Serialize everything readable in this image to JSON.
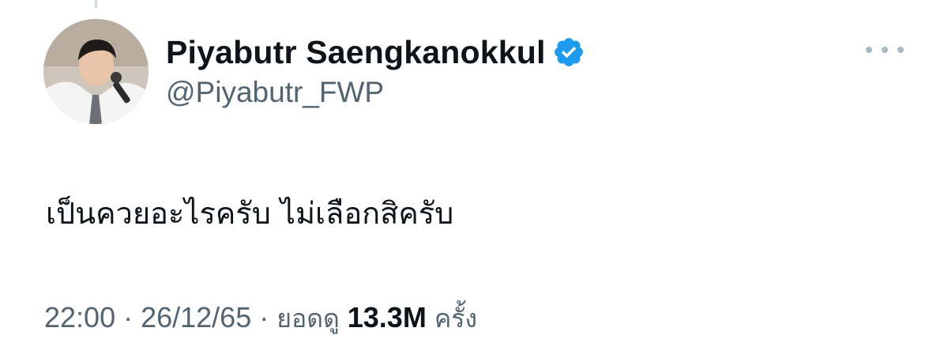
{
  "tweet": {
    "author": {
      "display_name": "Piyabutr Saengkanokkul",
      "handle": "@Piyabutr_FWP",
      "verified": true,
      "verified_icon": "verified-badge-icon"
    },
    "text": "เป็นควยอะไรครับ ไม่เลือกสิครับ",
    "meta": {
      "time": "22:00",
      "separator": "·",
      "date": "26/12/65",
      "views_prefix": "ยอดดู",
      "views_count": "13.3M",
      "views_suffix": "ครั้ง"
    },
    "more_icon": "more-options-icon"
  },
  "colors": {
    "text_primary": "#0f1419",
    "text_secondary": "#536471",
    "verified_blue": "#1d9bf0",
    "more_dots": "#aab8c2"
  }
}
